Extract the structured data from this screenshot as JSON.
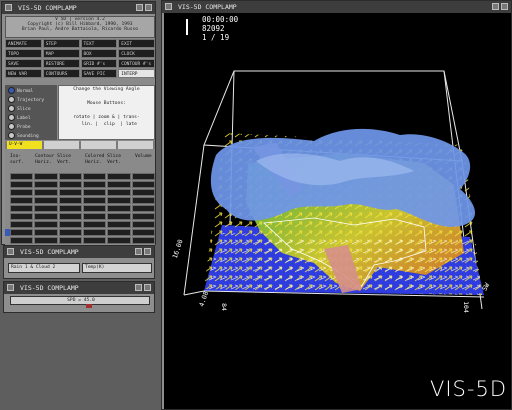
{
  "control_window": {
    "title": "VIS-5D COMPLAMP",
    "header_lines": [
      "V 5D | version 4.2",
      "Copyright (c) Bill Hibbard, 1990, 1993",
      "Brian Paul, Andre Battaiola, Ricardo Russo"
    ],
    "buttons": [
      {
        "label": "ANIMATE",
        "light": false
      },
      {
        "label": "STEP",
        "light": false
      },
      {
        "label": "TEXT",
        "light": false
      },
      {
        "label": "EXIT",
        "light": false
      },
      {
        "label": "TOPO",
        "light": false
      },
      {
        "label": "MAP",
        "light": false
      },
      {
        "label": "BOX",
        "light": false
      },
      {
        "label": "CLOCK",
        "light": false
      },
      {
        "label": "SAVE",
        "light": false
      },
      {
        "label": "RESTORE",
        "light": false
      },
      {
        "label": "GRID #'s",
        "light": false
      },
      {
        "label": "CONTOUR #'s",
        "light": false
      },
      {
        "label": "NEW VAR",
        "light": false
      },
      {
        "label": "CONTOURS",
        "light": false
      },
      {
        "label": "SAVE PIC",
        "light": false
      },
      {
        "label": "INTERP",
        "light": true
      }
    ],
    "modes": [
      {
        "label": "Normal",
        "on": true
      },
      {
        "label": "Trajectory",
        "on": false
      },
      {
        "label": "Slice",
        "on": false
      },
      {
        "label": "Label",
        "on": false
      },
      {
        "label": "Probe",
        "on": false
      },
      {
        "label": "Sounding",
        "on": false
      }
    ],
    "help_lines": [
      "Change the Viewing Angle",
      "",
      "Mouse Buttons:",
      "",
      "rotate | zoom & | trans-",
      "  lin. |  clip  | late"
    ],
    "selector_chips": [
      {
        "label": "U-V-W",
        "bg": "#f0e020",
        "fg": "#111"
      },
      {
        "label": "",
        "bg": "#d0d0d0",
        "fg": "#111"
      },
      {
        "label": "",
        "bg": "#d0d0d0",
        "fg": "#111"
      },
      {
        "label": "",
        "bg": "#d0d0d0",
        "fg": "#111"
      }
    ],
    "column_headers": [
      "Iso-\nsurf.",
      "Contour Slice\nHoriz.  Vert.",
      "Colored Slice\nHoriz.  Vert.",
      "Volume"
    ],
    "matrix_rows": 9,
    "matrix_cols": 6,
    "highlight_row": 7
  },
  "time_window": {
    "title": "VIS-5D COMPLAMP",
    "field1": "Rain 1 & Cloud 2",
    "field2": "Temp(K)"
  },
  "third_window": {
    "title": "VIS-5D COMPLAMP",
    "slider_label": "SPD = 45.0"
  },
  "view_window": {
    "title": "VIS-5D COMPLAMP",
    "time": "00:00:00",
    "date": "82092",
    "frame": "1 / 19",
    "axis_labels": [
      "16.00",
      "4.08",
      "84",
      "104",
      "SW"
    ],
    "brand": "VIS-5D"
  }
}
